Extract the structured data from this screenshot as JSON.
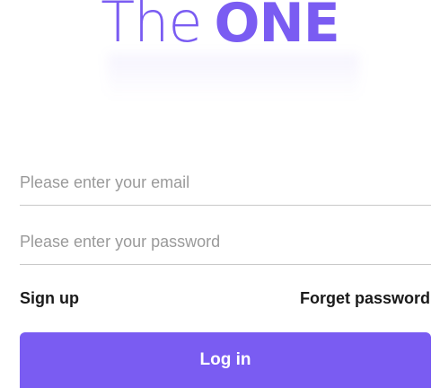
{
  "logo": {
    "part1": "The",
    "part2": "ONE"
  },
  "form": {
    "email_placeholder": "Please enter your email",
    "password_placeholder": "Please enter your password"
  },
  "links": {
    "sign_up": "Sign up",
    "forget_password": "Forget password"
  },
  "actions": {
    "login_label": "Log in"
  },
  "colors": {
    "brand": "#7a5cf2",
    "divider": "#c9c9c9",
    "placeholder": "#9a9a9a",
    "text": "#1a1a1a"
  }
}
